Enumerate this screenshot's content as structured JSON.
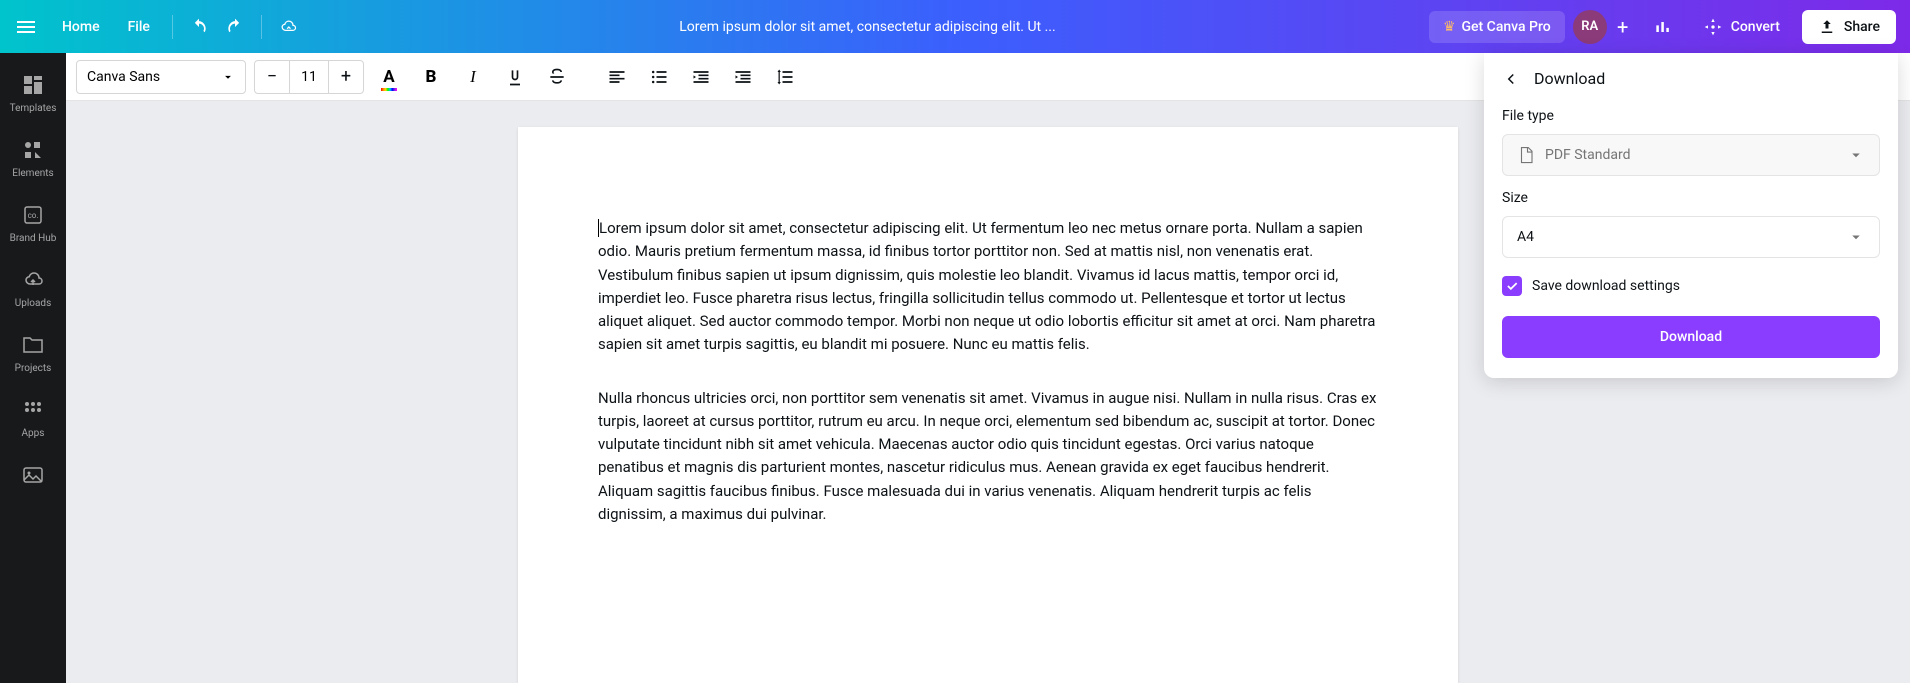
{
  "header": {
    "home": "Home",
    "file": "File",
    "title": "Lorem ipsum dolor sit amet, consectetur adipiscing elit. Ut ...",
    "pro": "Get Canva Pro",
    "avatar": "RA",
    "convert": "Convert",
    "share": "Share"
  },
  "sidebar": {
    "templates": "Templates",
    "elements": "Elements",
    "brandhub": "Brand Hub",
    "uploads": "Uploads",
    "projects": "Projects",
    "apps": "Apps"
  },
  "toolbar": {
    "font": "Canva Sans",
    "size": "11",
    "dec": "−",
    "inc": "+",
    "colorA": "A",
    "bold": "B",
    "italic": "I"
  },
  "document": {
    "p1": "Lorem ipsum dolor sit amet, consectetur adipiscing elit. Ut fermentum leo nec metus ornare porta. Nullam a sapien odio. Mauris pretium fermentum massa, id finibus tortor porttitor non. Sed at mattis nisl, non venenatis erat. Vestibulum finibus sapien ut ipsum dignissim, quis molestie leo blandit. Vivamus id lacus mattis, tempor orci id, imperdiet leo. Fusce pharetra risus lectus, fringilla sollicitudin tellus commodo ut. Pellentesque et tortor ut lectus aliquet aliquet. Sed auctor commodo tempor. Morbi non neque ut odio lobortis efficitur sit amet at orci. Nam pharetra sapien sit amet turpis sagittis, eu blandit mi posuere. Nunc eu mattis felis.",
    "p2": "Nulla rhoncus ultricies orci, non porttitor sem venenatis sit amet. Vivamus in augue nisi. Nullam in nulla risus. Cras ex turpis, laoreet at cursus porttitor, rutrum eu arcu. In neque orci, elementum sed bibendum ac, suscipit at tortor. Donec vulputate tincidunt nibh sit amet vehicula. Maecenas auctor odio quis tincidunt egestas. Orci varius natoque penatibus et magnis dis parturient montes, nascetur ridiculus mus. Aenean gravida ex eget faucibus hendrerit. Aliquam sagittis faucibus finibus. Fusce malesuada dui in varius venenatis. Aliquam hendrerit turpis ac felis dignissim, a maximus dui pulvinar."
  },
  "panel": {
    "title": "Download",
    "filetype_label": "File type",
    "filetype_value": "PDF Standard",
    "size_label": "Size",
    "size_value": "A4",
    "save_settings": "Save download settings",
    "download_btn": "Download"
  }
}
